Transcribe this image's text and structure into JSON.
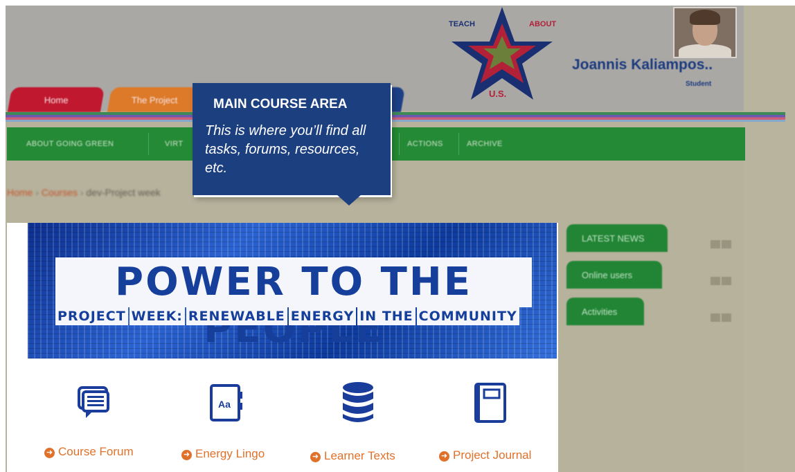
{
  "header": {
    "logo": {
      "line1_left": "TEACH",
      "line1_right": "ABOUT",
      "line2": "U.S."
    },
    "user": {
      "name": "Joannis Kaliampos..",
      "role": "Student"
    }
  },
  "tabs": [
    {
      "label": "Home"
    },
    {
      "label": "The Project"
    }
  ],
  "nav": [
    {
      "label": "ABOUT GOING GREEN"
    },
    {
      "label": "VIRT"
    },
    {
      "label": "ACTIONS"
    },
    {
      "label": "ARCHIVE"
    }
  ],
  "breadcrumb": {
    "home": "Home",
    "courses": "Courses",
    "current": "dev-Project week"
  },
  "banner": {
    "title": "POWER TO THE PEOPLE",
    "subtitle": [
      "PROJECT",
      "WEEK:",
      "RENEWABLE",
      "ENERGY",
      "IN THE",
      "COMMUNITY"
    ]
  },
  "course_links": [
    {
      "icon": "forum-icon",
      "label": "Course Forum"
    },
    {
      "icon": "glossary-book-icon",
      "label": "Energy Lingo"
    },
    {
      "icon": "database-icon",
      "label": "Learner Texts"
    },
    {
      "icon": "journal-icon",
      "label": "Project Journal"
    }
  ],
  "blocks": [
    {
      "label": "LATEST NEWS"
    },
    {
      "label": "Online users"
    },
    {
      "label": "Activities"
    }
  ],
  "tooltip": {
    "title": "MAIN COURSE AREA",
    "text": "This is where you’ll find all tasks, forums, resources, etc."
  },
  "colors": {
    "brand_blue": "#1c3f80",
    "nav_green": "#248a35",
    "link_orange": "#e0712a",
    "tab_red": "#c0182f",
    "tab_orange": "#dd7a2a"
  }
}
